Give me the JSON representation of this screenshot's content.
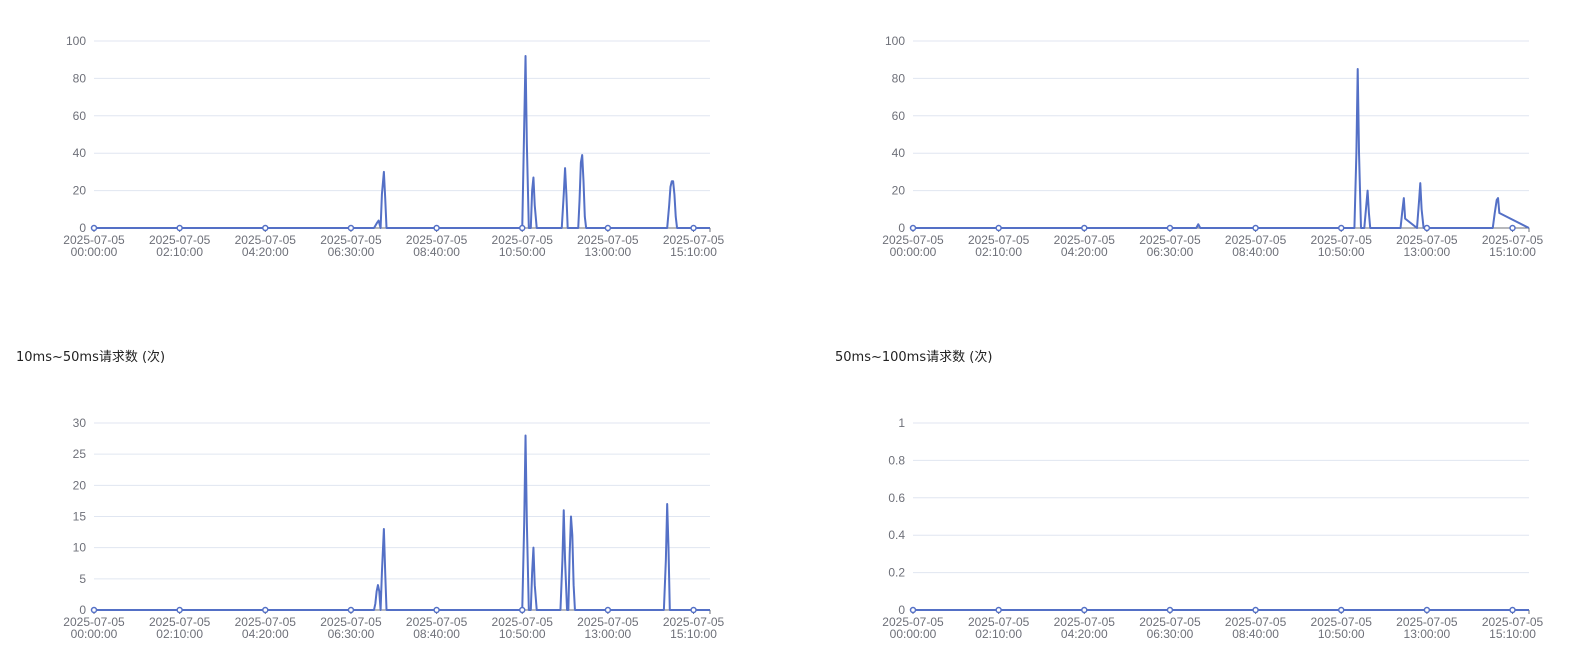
{
  "colors": {
    "series": "#5470c6",
    "grid": "#e0e6f1",
    "axis": "#6e7079"
  },
  "chart_data": [
    {
      "type": "line",
      "title": "",
      "ylim": [
        0,
        100
      ],
      "yticks": [
        0,
        20,
        40,
        60,
        80,
        100
      ],
      "x_range": [
        0,
        935
      ],
      "x_tick_values": [
        0,
        130,
        260,
        390,
        520,
        650,
        780,
        910
      ],
      "x_tick_labels": [
        [
          "2025-07-05",
          "00:00:00"
        ],
        [
          "2025-07-05",
          "02:10:00"
        ],
        [
          "2025-07-05",
          "04:20:00"
        ],
        [
          "2025-07-05",
          "06:30:00"
        ],
        [
          "2025-07-05",
          "08:40:00"
        ],
        [
          "2025-07-05",
          "10:50:00"
        ],
        [
          "2025-07-05",
          "13:00:00"
        ],
        [
          "2025-07-05",
          "15:10:00"
        ]
      ],
      "series": [
        {
          "x": [
            0,
            425,
            430,
            432,
            435,
            437,
            440,
            442,
            444,
            650,
            653,
            655,
            657,
            660,
            663,
            665,
            667,
            669,
            672,
            674,
            676,
            678,
            710,
            713,
            715,
            717,
            719,
            735,
            737,
            739,
            741,
            743,
            745,
            747,
            870,
            873,
            875,
            877,
            879,
            881,
            883,
            885,
            935
          ],
          "values": [
            0,
            0,
            3,
            4,
            0,
            18,
            30,
            16,
            0,
            0,
            55,
            92,
            45,
            0,
            0,
            20,
            27,
            12,
            0,
            0,
            0,
            0,
            0,
            18,
            32,
            18,
            0,
            0,
            15,
            35,
            39,
            25,
            6,
            0,
            0,
            12,
            22,
            25,
            25,
            18,
            6,
            0,
            0
          ]
        }
      ]
    },
    {
      "type": "line",
      "title": "",
      "ylim": [
        0,
        100
      ],
      "yticks": [
        0,
        20,
        40,
        60,
        80,
        100
      ],
      "x_range": [
        0,
        935
      ],
      "x_tick_values": [
        0,
        130,
        260,
        390,
        520,
        650,
        780,
        910
      ],
      "x_tick_labels": [
        [
          "2025-07-05",
          "00:00:00"
        ],
        [
          "2025-07-05",
          "02:10:00"
        ],
        [
          "2025-07-05",
          "04:20:00"
        ],
        [
          "2025-07-05",
          "06:30:00"
        ],
        [
          "2025-07-05",
          "08:40:00"
        ],
        [
          "2025-07-05",
          "10:50:00"
        ],
        [
          "2025-07-05",
          "13:00:00"
        ],
        [
          "2025-07-05",
          "15:10:00"
        ]
      ],
      "series": [
        {
          "x": [
            0,
            430,
            433,
            436,
            670,
            673,
            675,
            677,
            680,
            685,
            688,
            690,
            692,
            694,
            740,
            743,
            745,
            747,
            765,
            768,
            770,
            772,
            775,
            880,
            883,
            886,
            888,
            890,
            935
          ],
          "values": [
            0,
            0,
            2,
            0,
            0,
            40,
            85,
            40,
            0,
            0,
            12,
            20,
            8,
            0,
            0,
            10,
            16,
            5,
            0,
            14,
            24,
            10,
            0,
            0,
            8,
            15,
            16,
            8,
            0
          ]
        }
      ]
    },
    {
      "type": "line",
      "title": "10ms~50ms请求数 (次)",
      "ylim": [
        0,
        30
      ],
      "yticks": [
        0,
        5,
        10,
        15,
        20,
        25,
        30
      ],
      "x_range": [
        0,
        935
      ],
      "x_tick_values": [
        0,
        130,
        260,
        390,
        520,
        650,
        780,
        910
      ],
      "x_tick_labels": [
        [
          "2025-07-05",
          "00:00:00"
        ],
        [
          "2025-07-05",
          "02:10:00"
        ],
        [
          "2025-07-05",
          "04:20:00"
        ],
        [
          "2025-07-05",
          "06:30:00"
        ],
        [
          "2025-07-05",
          "08:40:00"
        ],
        [
          "2025-07-05",
          "10:50:00"
        ],
        [
          "2025-07-05",
          "13:00:00"
        ],
        [
          "2025-07-05",
          "15:10:00"
        ]
      ],
      "series": [
        {
          "x": [
            0,
            425,
            427,
            429,
            431,
            433,
            435,
            437,
            440,
            442,
            444,
            650,
            653,
            655,
            657,
            660,
            663,
            665,
            667,
            669,
            672,
            708,
            711,
            713,
            715,
            718,
            720,
            722,
            724,
            726,
            728,
            730,
            865,
            868,
            870,
            872,
            874,
            935
          ],
          "values": [
            0,
            0,
            1,
            3,
            4,
            3,
            0,
            6,
            13,
            6,
            0,
            0,
            14,
            28,
            14,
            0,
            0,
            6,
            10,
            4,
            0,
            0,
            8,
            16,
            8,
            0,
            0,
            9,
            15,
            12,
            4,
            0,
            0,
            8,
            17,
            10,
            0,
            0
          ]
        }
      ]
    },
    {
      "type": "line",
      "title": "50ms~100ms请求数 (次)",
      "ylim": [
        0,
        1
      ],
      "yticks": [
        "0",
        "0.2",
        "0.4",
        "0.6",
        "0.8",
        "1"
      ],
      "x_range": [
        0,
        935
      ],
      "x_tick_values": [
        0,
        130,
        260,
        390,
        520,
        650,
        780,
        910
      ],
      "x_tick_labels": [
        [
          "2025-07-05",
          "00:00:00"
        ],
        [
          "2025-07-05",
          "02:10:00"
        ],
        [
          "2025-07-05",
          "04:20:00"
        ],
        [
          "2025-07-05",
          "06:30:00"
        ],
        [
          "2025-07-05",
          "08:40:00"
        ],
        [
          "2025-07-05",
          "10:50:00"
        ],
        [
          "2025-07-05",
          "13:00:00"
        ],
        [
          "2025-07-05",
          "15:10:00"
        ]
      ],
      "series": [
        {
          "x": [
            0,
            935
          ],
          "values": [
            0,
            0
          ]
        }
      ]
    }
  ]
}
